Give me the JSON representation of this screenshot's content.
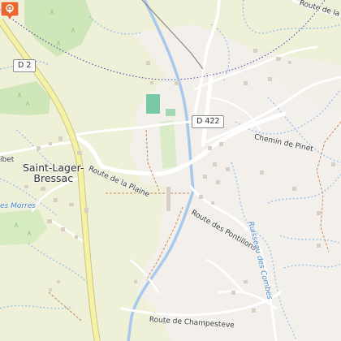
{
  "map": {
    "roads": {
      "d2": "D 2",
      "d422": "D 422",
      "route_de_la_plaine": "Route de la Plaine",
      "chemin_de_pinet": "Chemin de Pinet",
      "route_des_pontillons": "Route des Pontillons",
      "route_de_champesteve": "Route de Champesteve",
      "route_de_la_gare": "Route de la Gare",
      "ibet_fragment": "ibet"
    },
    "places": {
      "town_line1": "Saint-Lager-",
      "town_line2": "Bressac"
    },
    "water": {
      "ruisseau_des_combes": "Ruisseau des Combes",
      "morres_fragment": "es Morres"
    },
    "marker": {
      "name": "location-pin",
      "color": "#f0652f"
    },
    "colors": {
      "background": "#eef0d8",
      "urban": "#f3f0ec",
      "wood": "#cfe7b8",
      "major_road": "#f6f1a8",
      "river": "#a8c8ec",
      "boundary": "#3a3aa8"
    }
  }
}
